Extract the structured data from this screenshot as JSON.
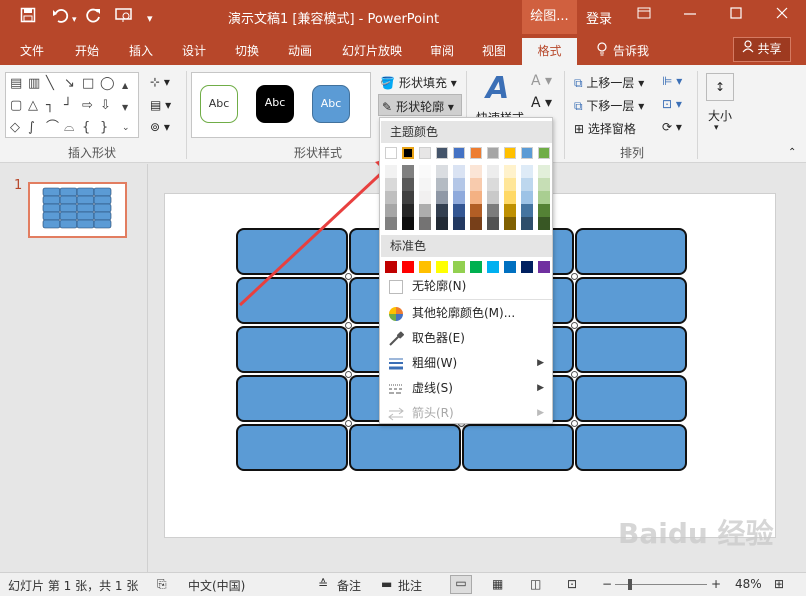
{
  "titlebar": {
    "title": "演示文稿1 [兼容模式] - PowerPoint",
    "contextual_tab": "绘图...",
    "login": "登录",
    "qat_icons": [
      "save-icon",
      "undo-icon",
      "redo-icon",
      "present-icon",
      "customize-icon"
    ]
  },
  "tabs": [
    "文件",
    "开始",
    "插入",
    "设计",
    "切换",
    "动画",
    "幻灯片放映",
    "审阅",
    "视图",
    "格式"
  ],
  "tell_me": "告诉我",
  "share": "共享",
  "ribbon": {
    "group_insert_shapes": "插入形状",
    "group_shape_styles": "形状样式",
    "group_arrange": "排列",
    "style_thumb_label": "Abc",
    "shape_fill": "形状填充",
    "shape_outline": "形状轮廓",
    "quick_styles": "快速样式",
    "bring_forward": "上移一层",
    "send_backward": "下移一层",
    "selection_pane": "选择窗格",
    "size": "大小"
  },
  "dropdown": {
    "theme_colors_header": "主题颜色",
    "standard_colors_header": "标准色",
    "theme_row": [
      "#ffffff",
      "#000000",
      "#e7e6e6",
      "#44546a",
      "#4472c4",
      "#ed7d31",
      "#a5a5a5",
      "#ffc000",
      "#5b9bd5",
      "#70ad47"
    ],
    "standard_row": [
      "#c00000",
      "#ff0000",
      "#ffc000",
      "#ffff00",
      "#92d050",
      "#00b050",
      "#00b0f0",
      "#0070c0",
      "#002060",
      "#7030a0"
    ],
    "selected_color": "#000000",
    "no_outline": "无轮廓(N)",
    "more_colors": "其他轮廓颜色(M)...",
    "eyedropper": "取色器(E)",
    "weight": "粗细(W)",
    "dashes": "虚线(S)",
    "arrows": "箭头(R)"
  },
  "slide_panel": {
    "slide_number": "1"
  },
  "statusbar": {
    "slide_info": "幻灯片 第 1 张，共 1 张",
    "language": "中文(中国)",
    "notes": "备注",
    "comments": "批注",
    "zoom": "48%"
  },
  "watermark": "Baidu 经验",
  "colors": {
    "accent": "#b7472a",
    "shape_fill": "#5b9bd5",
    "arrow": "#e8403f"
  }
}
